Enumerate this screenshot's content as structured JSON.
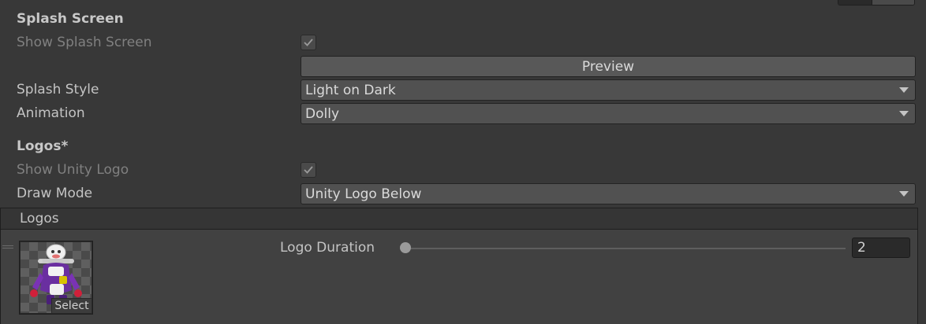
{
  "splash": {
    "section_title": "Splash Screen",
    "show_splash_label": "Show Splash Screen",
    "show_splash_checked": true,
    "preview_label": "Preview",
    "style_label": "Splash Style",
    "style_value": "Light on Dark",
    "animation_label": "Animation",
    "animation_value": "Dolly"
  },
  "logos": {
    "section_title": "Logos*",
    "show_unity_logo_label": "Show Unity Logo",
    "show_unity_logo_checked": true,
    "draw_mode_label": "Draw Mode",
    "draw_mode_value": "Unity Logo Below",
    "list_header": "Logos",
    "items": [
      {
        "select_label": "Select",
        "duration_label": "Logo Duration",
        "duration_value": "2"
      }
    ]
  },
  "icons": {
    "checkmark": "checkmark-icon",
    "dropdown": "chevron-down-icon",
    "drag": "drag-handle-icon"
  }
}
